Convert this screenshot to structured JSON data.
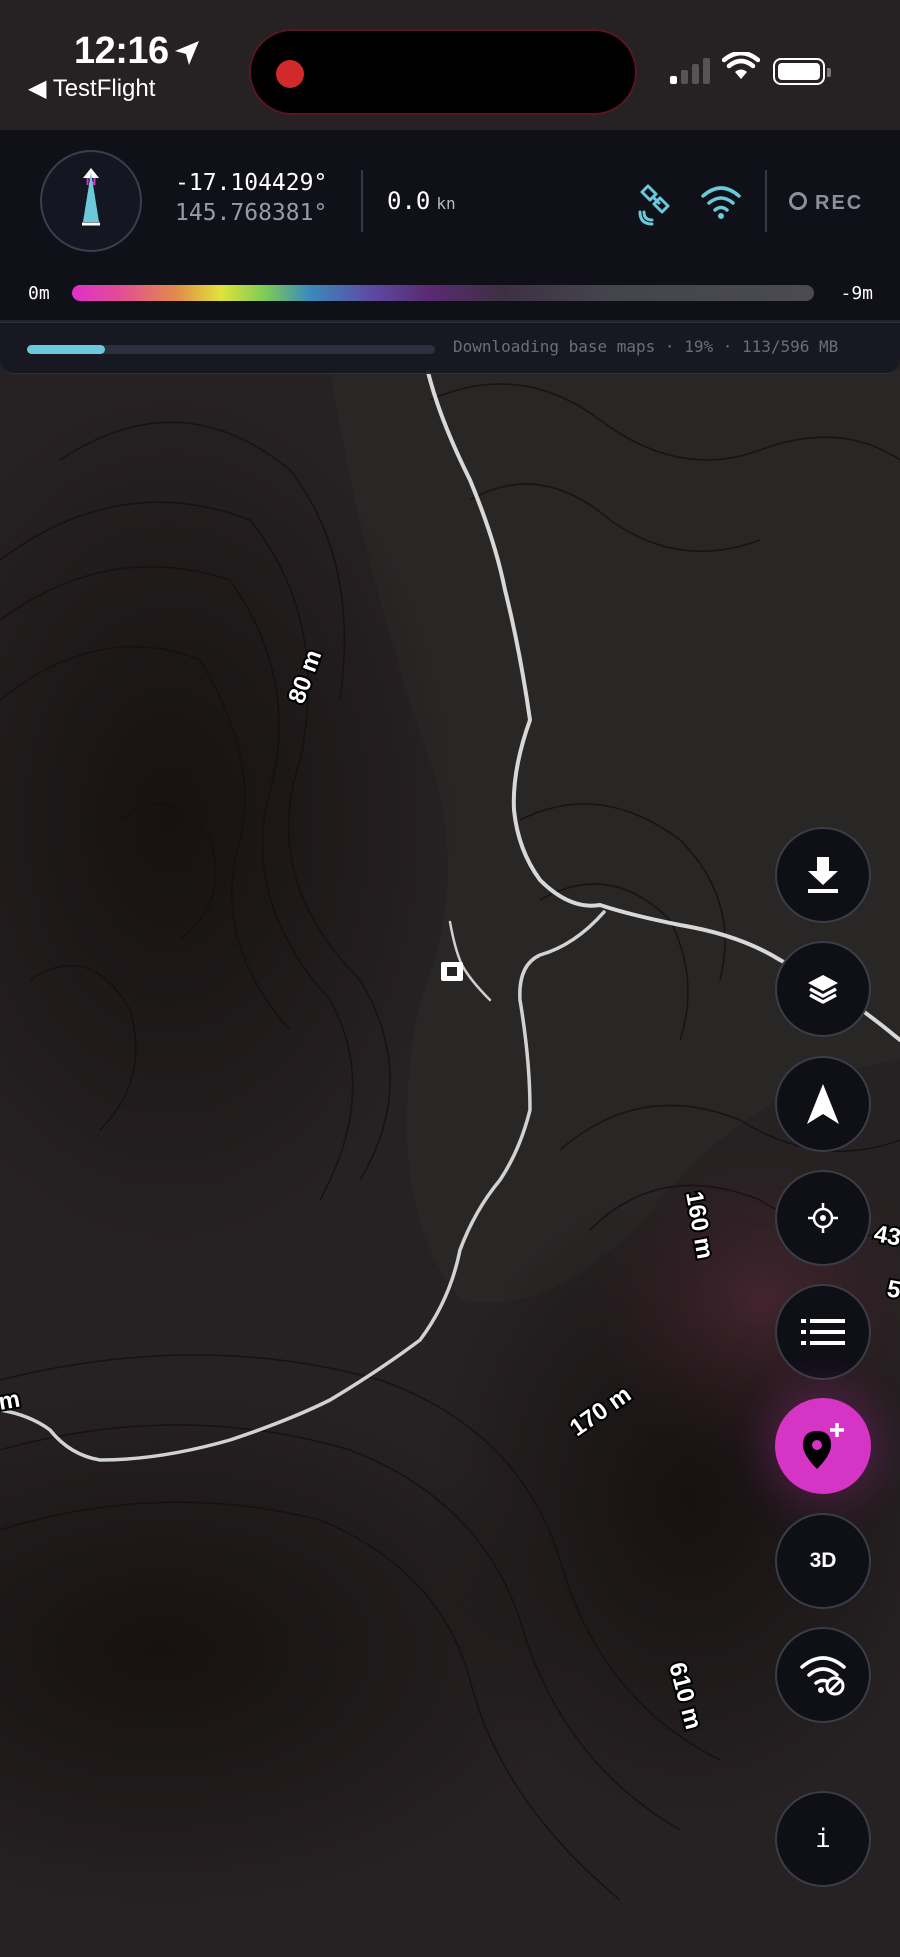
{
  "status_bar": {
    "time": "12:16",
    "back_label": "◀ TestFlight"
  },
  "hud": {
    "latitude": "-17.104429°",
    "longitude": "145.768381°",
    "speed_value": "0.0",
    "speed_unit": "kn",
    "record_label": "REC",
    "depth_scale_min": "0m",
    "depth_scale_max": "-9m",
    "compass_label": "N"
  },
  "download": {
    "progress_fraction": 0.19,
    "status_text": "Downloading base maps · 19% · 113/596 MB"
  },
  "map": {
    "contour_labels": [
      "80 m",
      "160 m",
      "170 m",
      "610 m",
      "43",
      "5",
      "m"
    ]
  },
  "controls": [
    {
      "name": "download-maps-button",
      "icon": "download-icon"
    },
    {
      "name": "layers-button",
      "icon": "layers-icon"
    },
    {
      "name": "navigation-mode-button",
      "icon": "navigation-arrow-icon"
    },
    {
      "name": "center-location-button",
      "icon": "crosshair-icon"
    },
    {
      "name": "list-button",
      "icon": "list-icon"
    },
    {
      "name": "add-waypoint-button",
      "icon": "add-pin-icon"
    },
    {
      "name": "3d-toggle-button",
      "icon": "3d-label",
      "label": "3D"
    },
    {
      "name": "offline-toggle-button",
      "icon": "wifi-off-icon"
    },
    {
      "name": "info-button",
      "icon": "info-icon",
      "label": "i"
    }
  ],
  "colors": {
    "accent_pink": "#d534c4",
    "accent_cyan": "#6ac9da",
    "record_dot": "#d22a2a",
    "map_background": "#201a1a"
  }
}
